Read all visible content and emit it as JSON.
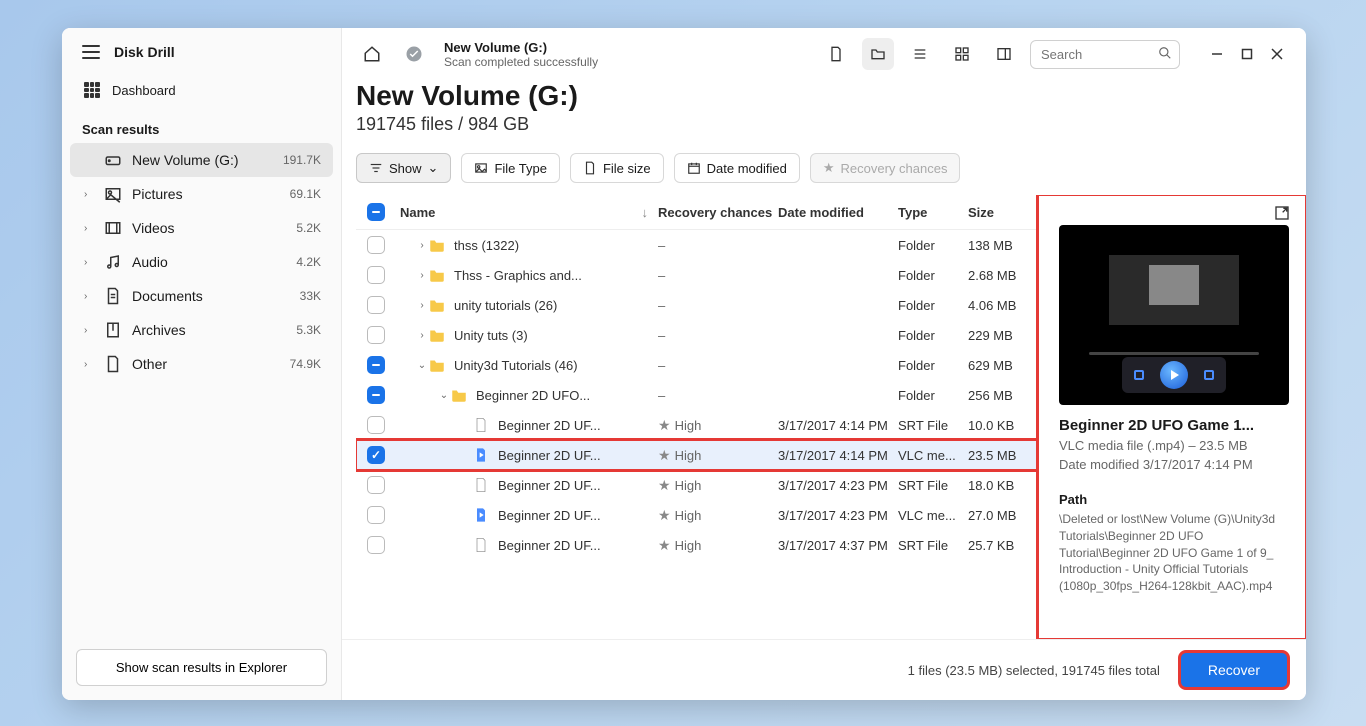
{
  "app": {
    "title": "Disk Drill"
  },
  "sidebar": {
    "dashboard": "Dashboard",
    "section": "Scan results",
    "items": [
      {
        "label": "New Volume (G:)",
        "count": "191.7K",
        "active": true,
        "icon": "drive",
        "chevron": ""
      },
      {
        "label": "Pictures",
        "count": "69.1K",
        "icon": "image",
        "chevron": "›"
      },
      {
        "label": "Videos",
        "count": "5.2K",
        "icon": "video",
        "chevron": "›"
      },
      {
        "label": "Audio",
        "count": "4.2K",
        "icon": "audio",
        "chevron": "›"
      },
      {
        "label": "Documents",
        "count": "33K",
        "icon": "doc",
        "chevron": "›"
      },
      {
        "label": "Archives",
        "count": "5.3K",
        "icon": "archive",
        "chevron": "›"
      },
      {
        "label": "Other",
        "count": "74.9K",
        "icon": "other",
        "chevron": "›"
      }
    ],
    "footer_btn": "Show scan results in Explorer"
  },
  "header": {
    "crumb_title": "New Volume (G:)",
    "crumb_sub": "Scan completed successfully",
    "search_placeholder": "Search"
  },
  "page": {
    "title": "New Volume (G:)",
    "subtitle": "191745 files / 984 GB"
  },
  "filters": {
    "show": "Show",
    "file_type": "File Type",
    "file_size": "File size",
    "date_modified": "Date modified",
    "recovery_chances": "Recovery chances"
  },
  "columns": {
    "name": "Name",
    "chances": "Recovery chances",
    "date": "Date modified",
    "type": "Type",
    "size": "Size"
  },
  "rows": [
    {
      "indent": 0,
      "chevron": "›",
      "icon": "folder",
      "name": "thss (1322)",
      "chances": "–",
      "date": "",
      "type": "Folder",
      "size": "138 MB",
      "check": "empty"
    },
    {
      "indent": 0,
      "chevron": "›",
      "icon": "folder",
      "name": "Thss - Graphics and...",
      "chances": "–",
      "date": "",
      "type": "Folder",
      "size": "2.68 MB",
      "check": "empty"
    },
    {
      "indent": 0,
      "chevron": "›",
      "icon": "folder",
      "name": "unity tutorials (26)",
      "chances": "–",
      "date": "",
      "type": "Folder",
      "size": "4.06 MB",
      "check": "empty"
    },
    {
      "indent": 0,
      "chevron": "›",
      "icon": "folder",
      "name": "Unity tuts (3)",
      "chances": "–",
      "date": "",
      "type": "Folder",
      "size": "229 MB",
      "check": "empty"
    },
    {
      "indent": 0,
      "chevron": "⌄",
      "icon": "folder",
      "name": "Unity3d Tutorials (46)",
      "chances": "–",
      "date": "",
      "type": "Folder",
      "size": "629 MB",
      "check": "indet"
    },
    {
      "indent": 1,
      "chevron": "⌄",
      "icon": "folder",
      "name": "Beginner 2D UFO...",
      "chances": "–",
      "date": "",
      "type": "Folder",
      "size": "256 MB",
      "check": "indet"
    },
    {
      "indent": 2,
      "chevron": "",
      "icon": "file",
      "name": "Beginner 2D UF...",
      "chances": "High",
      "date": "3/17/2017 4:14 PM",
      "type": "SRT File",
      "size": "10.0 KB",
      "check": "empty",
      "star": true
    },
    {
      "indent": 2,
      "chevron": "",
      "icon": "vlc",
      "name": "Beginner 2D UF...",
      "chances": "High",
      "date": "3/17/2017 4:14 PM",
      "type": "VLC me...",
      "size": "23.5 MB",
      "check": "checked",
      "star": true,
      "selected": true
    },
    {
      "indent": 2,
      "chevron": "",
      "icon": "file",
      "name": "Beginner 2D UF...",
      "chances": "High",
      "date": "3/17/2017 4:23 PM",
      "type": "SRT File",
      "size": "18.0 KB",
      "check": "empty",
      "star": true
    },
    {
      "indent": 2,
      "chevron": "",
      "icon": "vlc",
      "name": "Beginner 2D UF...",
      "chances": "High",
      "date": "3/17/2017 4:23 PM",
      "type": "VLC me...",
      "size": "27.0 MB",
      "check": "empty",
      "star": true
    },
    {
      "indent": 2,
      "chevron": "",
      "icon": "file",
      "name": "Beginner 2D UF...",
      "chances": "High",
      "date": "3/17/2017 4:37 PM",
      "type": "SRT File",
      "size": "25.7 KB",
      "check": "empty",
      "star": true
    }
  ],
  "preview": {
    "title": "Beginner 2D UFO Game 1...",
    "meta1": "VLC media file (.mp4) – 23.5 MB",
    "meta2": "Date modified 3/17/2017 4:14 PM",
    "path_label": "Path",
    "path": "\\Deleted or lost\\New Volume (G)\\Unity3d Tutorials\\Beginner 2D UFO Tutorial\\Beginner 2D UFO Game 1 of 9_ Introduction - Unity Official Tutorials (1080p_30fps_H264-128kbit_AAC).mp4"
  },
  "bottom": {
    "selection": "1 files (23.5 MB) selected, 191745 files total",
    "recover": "Recover"
  }
}
